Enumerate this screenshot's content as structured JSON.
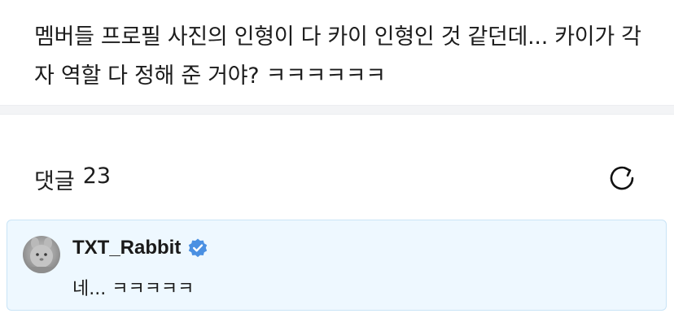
{
  "post": {
    "body": "멤버들 프로필 사진의 인형이 다 카이 인형인 것 같던데... 카이가 각자 역할 다 정해 준 거야? ㅋㅋㅋㅋㅋㅋ"
  },
  "comments": {
    "label": "댓글",
    "count": "23",
    "refresh_icon": "refresh-icon"
  },
  "comment": {
    "author": "TXT_Rabbit",
    "verified_icon": "verified-badge-icon",
    "verified_color": "#4a90e2",
    "text": "네... ㅋㅋㅋㅋㅋ",
    "highlight_bg": "#eef8ff",
    "highlight_border": "#c9e4f6"
  }
}
